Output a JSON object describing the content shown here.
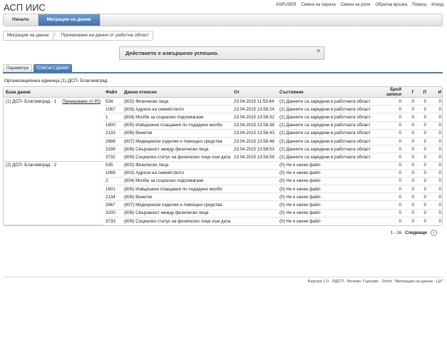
{
  "app": {
    "title": "АСП ИИС"
  },
  "top_links": [
    "ASPUSER",
    "Смяна на парола",
    "Смяна на роля",
    "Обратна връзка",
    "Помощ",
    "Изход"
  ],
  "nav": {
    "home": "Начало",
    "data_migration": "Миграция на данни"
  },
  "breadcrumb": {
    "parent": "Миграция на данни",
    "current": "Премахване на данни от работна област"
  },
  "message": {
    "text": "Действието е извършено успешно.",
    "close": "✕"
  },
  "subtabs": {
    "params": "Параметри",
    "list": "Списък с данни"
  },
  "org_unit": "Организационна единица (1) ДСП- Благоевград",
  "table": {
    "headers": {
      "db": "База данни",
      "file": "Файл",
      "data_about": "Данни относно",
      "from": "От",
      "state": "Състояние",
      "records": "Брой записи",
      "g": "Г",
      "p": "П",
      "i": "И"
    },
    "groups": [
      {
        "db": "(1) ДСП- Благоевград - 1",
        "link": "Премахване от РО",
        "rows": [
          {
            "file": "534",
            "about": "(802) Физически лица",
            "from": "23.04.2015 11:53:44",
            "state": "(2) Данните са заредени в работната област",
            "records": "0",
            "g": "0",
            "p": "0",
            "i": "0"
          },
          {
            "file": "1067",
            "about": "(803) Адреси на семейството",
            "from": "23.04.2015 13:58:24",
            "state": "(2) Данните са заредени в работната област",
            "records": "0",
            "g": "0",
            "p": "0",
            "i": "0"
          },
          {
            "file": "1",
            "about": "(804) Молби за социално подпомагане",
            "from": "23.04.2015 13:58:32",
            "state": "(2) Данните са заредени в работната област",
            "records": "0",
            "g": "0",
            "p": "0",
            "i": "0"
          },
          {
            "file": "1600",
            "about": "(805) Извършени плащания по подадени молби",
            "from": "23.04.2015 13:58:38",
            "state": "(2) Данните са заредени в работната област",
            "records": "0",
            "g": "0",
            "p": "0",
            "i": "0"
          },
          {
            "file": "2133",
            "about": "(806) Винетки",
            "from": "23.04.2015 13:58:43",
            "state": "(2) Данните са заредени в работната област",
            "records": "0",
            "g": "0",
            "p": "0",
            "i": "0"
          },
          {
            "file": "2666",
            "about": "(807) Медицински изделия и помощни средства",
            "from": "23.04.2015 13:58:48",
            "state": "(2) Данните са заредени в работната област",
            "records": "0",
            "g": "0",
            "p": "0",
            "i": "0"
          },
          {
            "file": "3199",
            "about": "(808) Свързаност между физически лица",
            "from": "23.04.2015 13:58:53",
            "state": "(2) Данните са заредени в работната област",
            "records": "0",
            "g": "0",
            "p": "0",
            "i": "0"
          },
          {
            "file": "3732",
            "about": "(809) Социален статус на физическо лице към дата",
            "from": "23.04.2015 13:58:58",
            "state": "(2) Данните са заредени в работната област",
            "records": "0",
            "g": "0",
            "p": "0",
            "i": "0"
          }
        ]
      },
      {
        "db": "(2) ДСП- Благоевград - 2",
        "link": "",
        "rows": [
          {
            "file": "535",
            "about": "(802) Физически лица",
            "from": "",
            "state": "(0) Не е качен файл",
            "records": "0",
            "g": "0",
            "p": "0",
            "i": "0"
          },
          {
            "file": "1068",
            "about": "(803) Адреси на семейството",
            "from": "",
            "state": "(0) Не е качен файл",
            "records": "0",
            "g": "0",
            "p": "0",
            "i": "0"
          },
          {
            "file": "2",
            "about": "(804) Молби за социално подпомагане",
            "from": "",
            "state": "(0) Не е качен файл",
            "records": "0",
            "g": "0",
            "p": "0",
            "i": "0"
          },
          {
            "file": "1601",
            "about": "(805) Извършени плащания по подадени молби",
            "from": "",
            "state": "(0) Не е качен файл",
            "records": "0",
            "g": "0",
            "p": "0",
            "i": "0"
          },
          {
            "file": "2134",
            "about": "(806) Винетки",
            "from": "",
            "state": "(0) Не е качен файл",
            "records": "0",
            "g": "0",
            "p": "0",
            "i": "0"
          },
          {
            "file": "2667",
            "about": "(807) Медицински изделия и помощни средства",
            "from": "",
            "state": "(0) Не е качен файл",
            "records": "0",
            "g": "0",
            "p": "0",
            "i": "0"
          },
          {
            "file": "3200",
            "about": "(808) Свързаност между физически лица",
            "from": "",
            "state": "(0) Не е качен файл",
            "records": "0",
            "g": "0",
            "p": "0",
            "i": "0"
          },
          {
            "file": "3733",
            "about": "(809) Социален статус на физическо лице към дата",
            "from": "",
            "state": "(0) Не е качен файл",
            "records": "0",
            "g": "0",
            "p": "0",
            "i": "0"
          }
        ]
      }
    ]
  },
  "pagination": {
    "range": "1 - 16",
    "next": "Следващи",
    "next_icon": "›"
  },
  "footer": {
    "version": "Версия 1.0",
    "office": "РДСП - Велико Търново",
    "role": "Роля: \"Миграция на данни - ЦУ\""
  }
}
